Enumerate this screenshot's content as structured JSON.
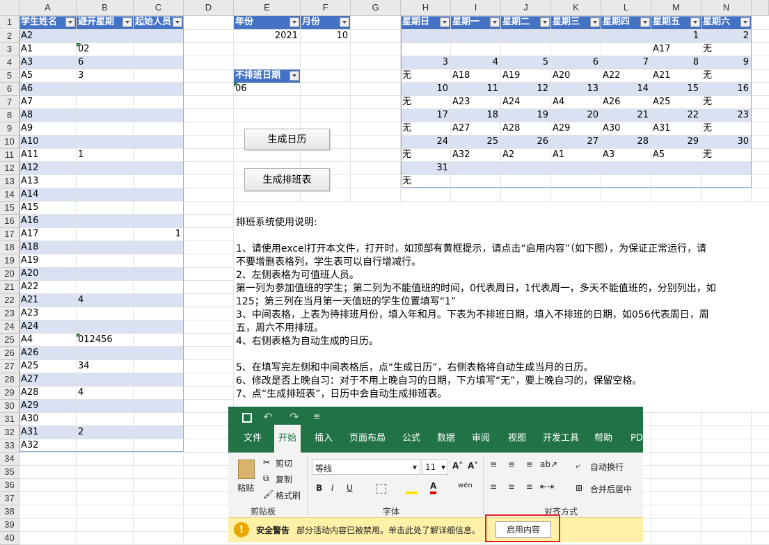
{
  "columns": [
    "A",
    "B",
    "C",
    "D",
    "E",
    "F",
    "G",
    "H",
    "I",
    "J",
    "K",
    "L",
    "M",
    "N"
  ],
  "rows": [
    "1",
    "2",
    "3",
    "4",
    "5",
    "6",
    "7",
    "8",
    "9",
    "10",
    "11",
    "12",
    "13",
    "14",
    "15",
    "16",
    "17",
    "18",
    "19",
    "20",
    "21",
    "22",
    "23",
    "24",
    "25",
    "26",
    "27",
    "28",
    "29",
    "30",
    "31",
    "32",
    "33",
    "34",
    "35",
    "36",
    "37",
    "38",
    "39",
    "40"
  ],
  "student_table": {
    "headers": [
      "学生姓名",
      "避开星期",
      "起始人员"
    ],
    "rows": [
      [
        "A2",
        "",
        ""
      ],
      [
        "A1",
        "02",
        ""
      ],
      [
        "A3",
        "6",
        ""
      ],
      [
        "A5",
        "3",
        ""
      ],
      [
        "A6",
        "",
        ""
      ],
      [
        "A7",
        "",
        ""
      ],
      [
        "A8",
        "",
        ""
      ],
      [
        "A9",
        "",
        ""
      ],
      [
        "A10",
        "",
        ""
      ],
      [
        "A11",
        "1",
        ""
      ],
      [
        "A12",
        "",
        ""
      ],
      [
        "A13",
        "",
        ""
      ],
      [
        "A14",
        "",
        ""
      ],
      [
        "A15",
        "",
        ""
      ],
      [
        "A16",
        "",
        ""
      ],
      [
        "A17",
        "",
        "1"
      ],
      [
        "A18",
        "",
        ""
      ],
      [
        "A19",
        "",
        ""
      ],
      [
        "A20",
        "",
        ""
      ],
      [
        "A22",
        "",
        ""
      ],
      [
        "A21",
        "4",
        ""
      ],
      [
        "A23",
        "",
        ""
      ],
      [
        "A24",
        "",
        ""
      ],
      [
        "A4",
        "012456",
        ""
      ],
      [
        "A26",
        "",
        ""
      ],
      [
        "A25",
        "34",
        ""
      ],
      [
        "A27",
        "",
        ""
      ],
      [
        "A28",
        "4",
        ""
      ],
      [
        "A29",
        "",
        ""
      ],
      [
        "A30",
        "",
        ""
      ],
      [
        "A31",
        "2",
        ""
      ],
      [
        "A32",
        "",
        ""
      ]
    ]
  },
  "year_table": {
    "headers": [
      "年份",
      "月份"
    ],
    "year": "2021",
    "month": "10"
  },
  "noshift_table": {
    "header": "不排班日期",
    "value": "06"
  },
  "buttons": {
    "gen_calendar": "生成日历",
    "gen_schedule": "生成排班表"
  },
  "calendar": {
    "headers": [
      "星期日",
      "星期一",
      "星期二",
      "星期三",
      "星期四",
      "星期五",
      "星期六"
    ],
    "rows": [
      [
        "",
        "",
        "",
        "",
        "",
        "1",
        "2"
      ],
      [
        "",
        "",
        "",
        "",
        "",
        "A17",
        "无"
      ],
      [
        "3",
        "4",
        "5",
        "6",
        "7",
        "8",
        "9"
      ],
      [
        "无",
        "A18",
        "A19",
        "A20",
        "A22",
        "A21",
        "无"
      ],
      [
        "10",
        "11",
        "12",
        "13",
        "14",
        "15",
        "16"
      ],
      [
        "无",
        "A23",
        "A24",
        "A4",
        "A26",
        "A25",
        "无"
      ],
      [
        "17",
        "18",
        "19",
        "20",
        "21",
        "22",
        "23"
      ],
      [
        "无",
        "A27",
        "A28",
        "A29",
        "A30",
        "A31",
        "无"
      ],
      [
        "24",
        "25",
        "26",
        "27",
        "28",
        "29",
        "30"
      ],
      [
        "无",
        "A32",
        "A2",
        "A1",
        "A3",
        "A5",
        "无"
      ],
      [
        "31",
        "",
        "",
        "",
        "",
        "",
        ""
      ],
      [
        "无",
        "",
        "",
        "",
        "",
        "",
        ""
      ]
    ]
  },
  "instructions": [
    "排班系统使用说明:",
    "",
    "1、请使用excel打开本文件，打开时，如顶部有黄框提示，请点击“启用内容”（如下图），为保证正常运行，请",
    "不要增删表格列，学生表可以自行增减行。",
    "2、左侧表格为可值班人员。",
    "第一列为参加值班的学生；第二列为不能值班的时间，0代表周日，1代表周一，多天不能值班的，分别列出，如",
    "125；第三列在当月第一天值班的学生位置填写“1”",
    "3、中间表格，上表为待排班月份，填入年和月。下表为不排班日期，填入不排班的日期，如056代表周日，周",
    "五，周六不用排班。",
    "4、右侧表格为自动生成的日历。",
    "",
    "5、在填写完左侧和中间表格后，点“生成日历”，右侧表格将自动生成当月的日历。",
    "6、修改是否上晚自习：对于不用上晚自习的日期，下方填写“无”，要上晚自习的，保留空格。",
    "7、点“生成排班表”，日历中会自动生成排班表。"
  ],
  "ribbon": {
    "tabs": [
      "文件",
      "开始",
      "插入",
      "页面布局",
      "公式",
      "数据",
      "审阅",
      "视图",
      "开发工具",
      "帮助",
      "PD"
    ],
    "paste": "粘贴",
    "cut": "剪切",
    "copy": "复制",
    "format_painter": "格式刷",
    "clipboard": "剪贴板",
    "font_name": "等线",
    "font_size": "11",
    "font_group": "字体",
    "wrap": "自动换行",
    "merge": "合并后居中",
    "align_group": "对齐方式",
    "warn_title": "安全警告",
    "warn_text": "部分活动内容已被禁用。单击此处了解详细信息。",
    "enable": "启用内容"
  }
}
